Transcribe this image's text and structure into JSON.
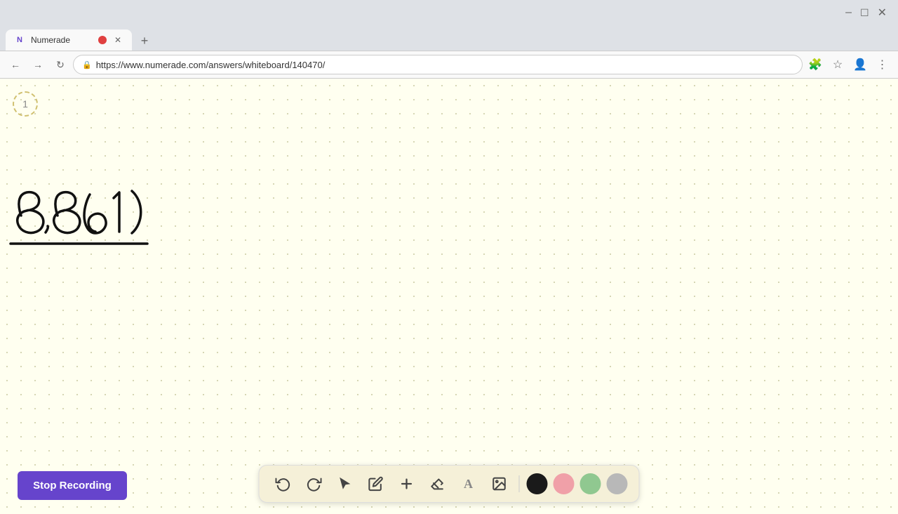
{
  "browser": {
    "tab": {
      "title": "Numerade",
      "url": "https://www.numerade.com/answers/whiteboard/140470/",
      "favicon": "N"
    },
    "nav": {
      "back_disabled": false,
      "forward_disabled": false
    }
  },
  "page": {
    "page_number": "1",
    "math_content": "8,861)"
  },
  "bottom_toolbar": {
    "buttons": [
      {
        "name": "undo",
        "icon": "↺",
        "label": "Undo"
      },
      {
        "name": "redo",
        "icon": "↻",
        "label": "Redo"
      },
      {
        "name": "select",
        "icon": "▶",
        "label": "Select"
      },
      {
        "name": "pen",
        "icon": "✏",
        "label": "Pen"
      },
      {
        "name": "add",
        "icon": "+",
        "label": "Add"
      },
      {
        "name": "eraser",
        "icon": "◻",
        "label": "Eraser"
      },
      {
        "name": "text",
        "icon": "A",
        "label": "Text"
      },
      {
        "name": "image",
        "icon": "🖼",
        "label": "Image"
      }
    ],
    "colors": [
      {
        "name": "black",
        "value": "#1a1a1a"
      },
      {
        "name": "pink",
        "value": "#f0a0a8"
      },
      {
        "name": "green",
        "value": "#90c890"
      },
      {
        "name": "gray",
        "value": "#b8b8b8"
      }
    ]
  },
  "stop_recording": {
    "label": "Stop Recording"
  }
}
